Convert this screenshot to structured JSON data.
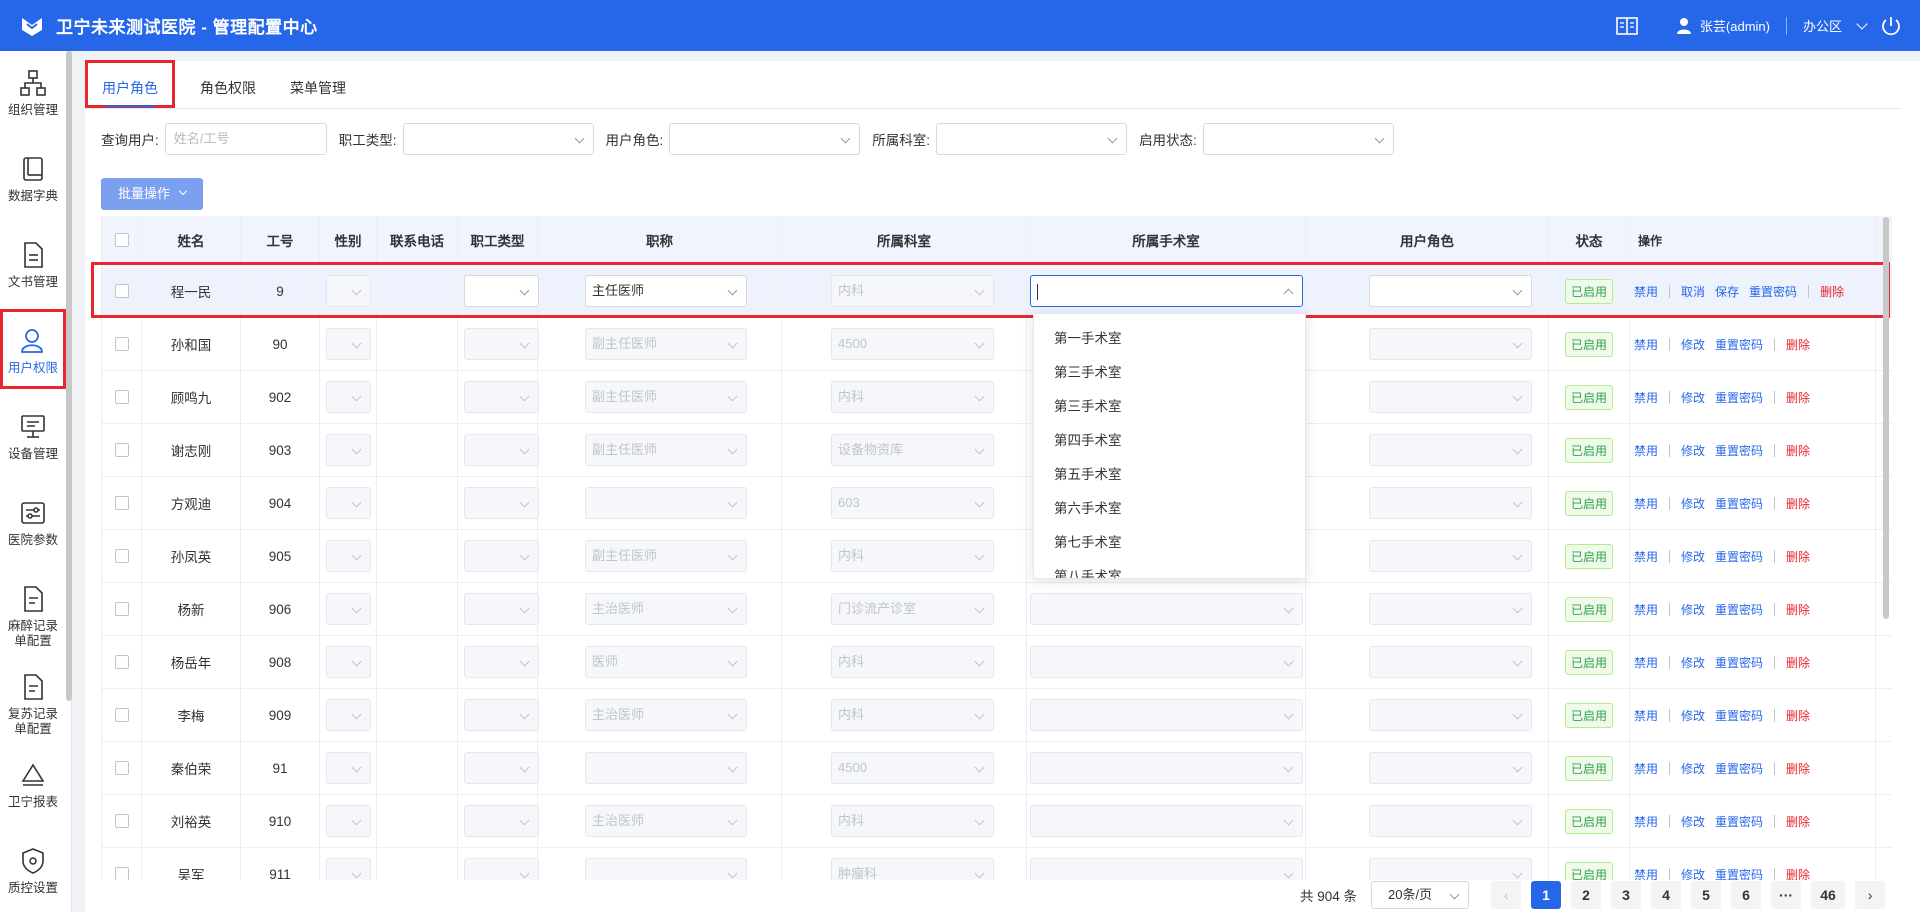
{
  "header": {
    "title": "卫宁未来测试医院 - 管理配置中心",
    "user": "张芸(admin)",
    "office": "办公区"
  },
  "sidebar": {
    "items": [
      {
        "label": "组织管理",
        "icon": "org-icon"
      },
      {
        "label": "数据字典",
        "icon": "book-icon"
      },
      {
        "label": "文书管理",
        "icon": "document-icon"
      },
      {
        "label": "用户权限",
        "icon": "user-icon",
        "active": true
      },
      {
        "label": "设备管理",
        "icon": "monitor-icon"
      },
      {
        "label": "医院参数",
        "icon": "settings-icon"
      },
      {
        "label": "麻醉记录单配置",
        "icon": "record-icon"
      },
      {
        "label": "复苏记录单配置",
        "icon": "record-icon"
      },
      {
        "label": "卫宁报表",
        "icon": "report-icon"
      },
      {
        "label": "质控设置",
        "icon": "shield-icon"
      }
    ]
  },
  "tabs": [
    "用户角色",
    "角色权限",
    "菜单管理"
  ],
  "filters": {
    "user_label": "查询用户:",
    "user_placeholder": "姓名/工号",
    "type_label": "职工类型:",
    "role_label": "用户角色:",
    "dept_label": "所属科室:",
    "status_label": "启用状态:"
  },
  "batch_label": "批量操作",
  "table": {
    "headers": [
      "姓名",
      "工号",
      "性别",
      "联系电话",
      "职工类型",
      "职称",
      "所属科室",
      "所属手术室",
      "用户角色",
      "状态",
      "操作"
    ],
    "rows": [
      {
        "name": "程一民",
        "id": "9",
        "title": "主任医师",
        "dept": "内科",
        "status": "已启用",
        "editing": true
      },
      {
        "name": "孙和国",
        "id": "90",
        "title": "副主任医师",
        "dept": "4500",
        "status": "已启用"
      },
      {
        "name": "顾鸣九",
        "id": "902",
        "title": "副主任医师",
        "dept": "内科",
        "status": "已启用"
      },
      {
        "name": "谢志刚",
        "id": "903",
        "title": "副主任医师",
        "dept": "设备物资库",
        "status": "已启用"
      },
      {
        "name": "方观迪",
        "id": "904",
        "title": "",
        "dept": "603",
        "status": "已启用"
      },
      {
        "name": "孙凤英",
        "id": "905",
        "title": "副主任医师",
        "dept": "内科",
        "status": "已启用"
      },
      {
        "name": "杨新",
        "id": "906",
        "title": "主治医师",
        "dept": "门诊流产诊室",
        "status": "已启用"
      },
      {
        "name": "杨岳年",
        "id": "908",
        "title": "医师",
        "dept": "内科",
        "status": "已启用"
      },
      {
        "name": "李梅",
        "id": "909",
        "title": "主治医师",
        "dept": "内科",
        "status": "已启用"
      },
      {
        "name": "秦伯荣",
        "id": "91",
        "title": "",
        "dept": "4500",
        "status": "已启用"
      },
      {
        "name": "刘裕英",
        "id": "910",
        "title": "主治医师",
        "dept": "内科",
        "status": "已启用"
      },
      {
        "name": "吴军",
        "id": "911",
        "title": "",
        "dept": "肿瘤科",
        "status": "已启用"
      }
    ],
    "ops": {
      "disable": "禁用",
      "modify": "修改",
      "cancel": "取消",
      "save": "保存",
      "reset": "重置密码",
      "delete": "删除"
    }
  },
  "dropdown": [
    "第一手术室",
    "第三手术室",
    "第三手术室",
    "第四手术室",
    "第五手术室",
    "第六手术室",
    "第七手术室",
    "第八手术室"
  ],
  "pagination": {
    "total": "共 904 条",
    "size": "20条/页",
    "pages": [
      "1",
      "2",
      "3",
      "4",
      "5",
      "6",
      "···",
      "46"
    ],
    "current": "1"
  }
}
